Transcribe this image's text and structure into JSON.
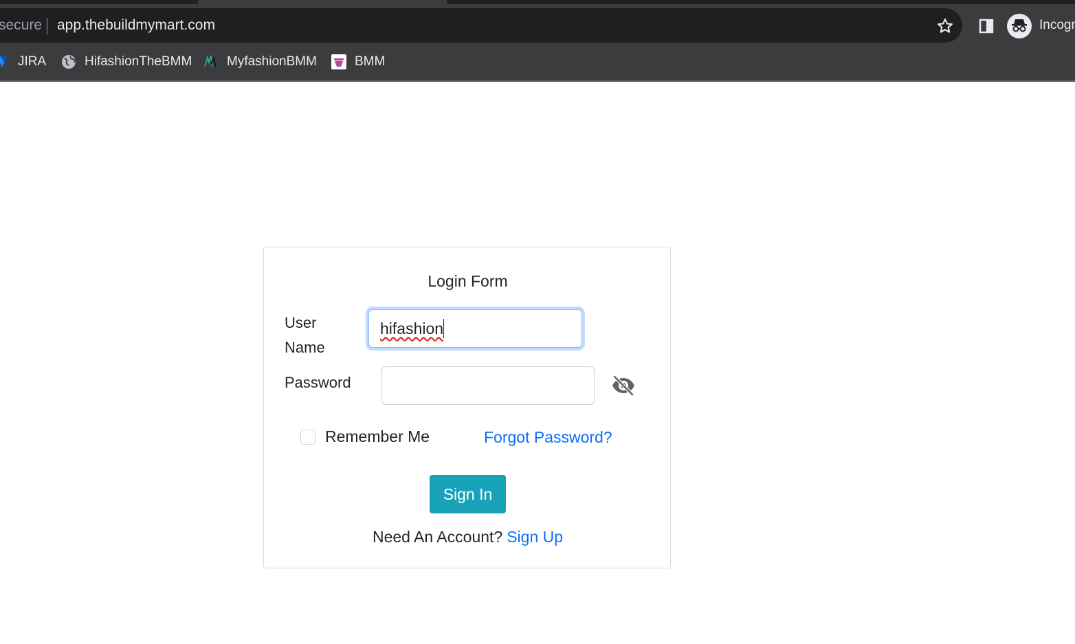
{
  "browser": {
    "secure_text": "secure",
    "url": "app.thebuildmymart.com",
    "profile_label": "Incognito",
    "icons": {
      "star": "star-icon",
      "side_panel": "side-panel-icon",
      "profile": "incognito-icon"
    }
  },
  "bookmarks": [
    {
      "label": "JIRA",
      "icon": "jira-icon"
    },
    {
      "label": "HifashionTheBMM",
      "icon": "globe-icon"
    },
    {
      "label": "MyfashionBMM",
      "icon": "myfashion-logo-icon"
    },
    {
      "label": "BMM",
      "icon": "bmm-logo-icon"
    }
  ],
  "login": {
    "title": "Login Form",
    "username_label": "User Name",
    "username_value": "hifashion",
    "password_label": "Password",
    "password_value": "",
    "toggle_icon": "eye-slash-icon",
    "remember_label": "Remember Me",
    "remember_checked": false,
    "forgot_label": "Forgot Password?",
    "signin_label": "Sign In",
    "account_prompt": "Need An Account?",
    "signup_label": "Sign Up"
  },
  "colors": {
    "chrome_bg": "#3c3c3e",
    "omnibox_bg": "#1f1f21",
    "link": "#0d6efd",
    "button": "#17a2b8",
    "focus_ring": "#86b7fe"
  }
}
